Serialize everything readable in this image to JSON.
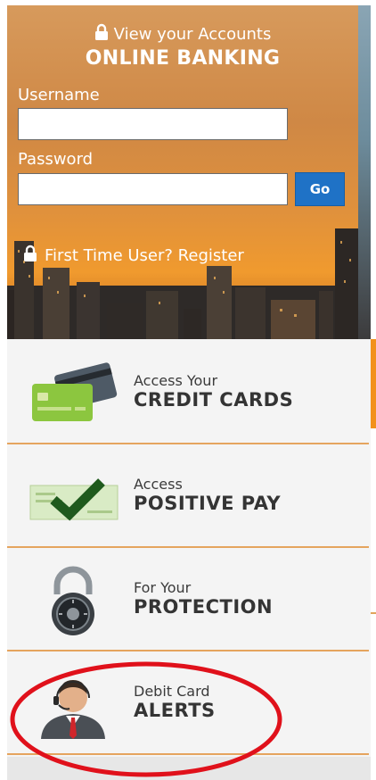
{
  "login": {
    "line1": "View your Accounts",
    "line2": "ONLINE BANKING",
    "username_label": "Username",
    "username_value": "",
    "password_label": "Password",
    "password_value": "",
    "go_label": "Go",
    "register_text": "First Time User? Register"
  },
  "menu": {
    "items": [
      {
        "small": "Access Your",
        "big": "CREDIT CARDS",
        "icon": "credit-cards-icon"
      },
      {
        "small": "Access",
        "big": "POSITIVE PAY",
        "icon": "check-mark-icon"
      },
      {
        "small": "For Your",
        "big": "PROTECTION",
        "icon": "padlock-icon"
      },
      {
        "small": "Debit Card",
        "big": "ALERTS",
        "icon": "support-agent-icon"
      }
    ]
  },
  "colors": {
    "go_button": "#1f72c6",
    "separator": "#e5a45e",
    "accent_orange": "#f2911b",
    "highlight_red": "#e0111b"
  }
}
